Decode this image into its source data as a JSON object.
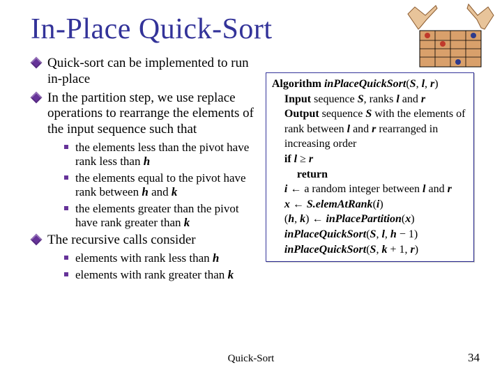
{
  "title": "In-Place Quick-Sort",
  "bullets": {
    "b1": "Quick-sort can be implemented to run in-place",
    "b2": "In the partition step, we use replace operations to rearrange the elements of the input sequence such that",
    "b2s1_a": "the elements less than the pivot have rank less than ",
    "b2s1_h": "h",
    "b2s2_a": "the elements equal to the pivot have rank between ",
    "b2s2_h": "h",
    "b2s2_and": " and ",
    "b2s2_k": "k",
    "b2s3_a": "the elements greater than the pivot have rank greater than ",
    "b2s3_k": "k",
    "b3": "The recursive calls consider",
    "b3s1_a": "elements with rank less than ",
    "b3s1_h": "h",
    "b3s2_a": "elements with rank greater than ",
    "b3s2_k": "k"
  },
  "algo": {
    "kw_algo": "Algorithm",
    "fname": "inPlaceQuickSort",
    "args_open": "(",
    "S": "S",
    "comma1": ", ",
    "l": "l",
    "comma2": ", ",
    "r": "r",
    "args_close": ")",
    "kw_input": "Input",
    "input_text_a": " sequence ",
    "input_text_b": ", ranks ",
    "input_text_c": " and ",
    "kw_output": "Output",
    "output_text_a": " sequence ",
    "output_text_b": " with the elements of rank between ",
    "output_text_c": " and ",
    "output_text_d": " rearranged in increasing order",
    "kw_if": "if",
    "if_cond_a": " ",
    "ge": " ≥ ",
    "kw_return": "return",
    "line_i_a": " ← a random integer between ",
    "line_i_b": " and ",
    "i": "i",
    "x": "x",
    "line_x_a": " ← ",
    "elemAtRank": "S.elemAtRank",
    "hk_open": "(",
    "h": "h",
    "k": "k",
    "hk_close": ")",
    "line_hk_a": " ← ",
    "inPlacePartition": "inPlacePartition",
    "call1_args": "(",
    "minus1": " − 1)",
    "plus1": " + 1, ",
    "comma": ", "
  },
  "footer": {
    "label": "Quick-Sort",
    "pagenum": "34"
  }
}
